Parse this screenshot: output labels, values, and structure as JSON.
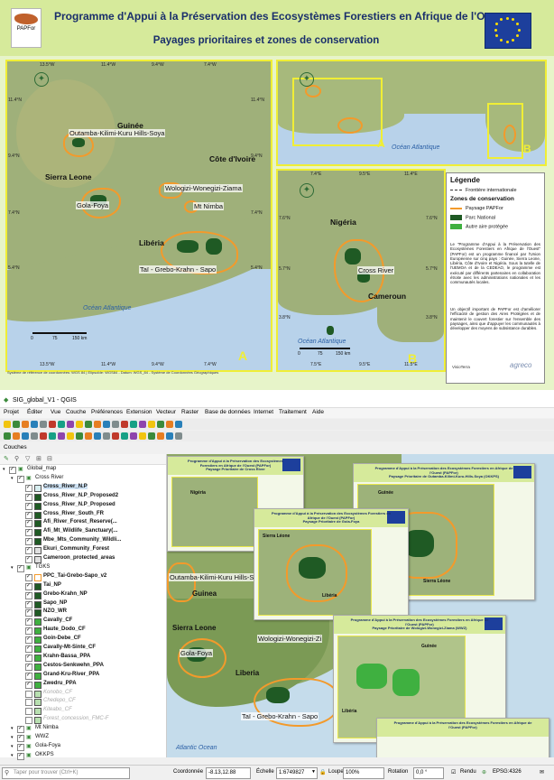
{
  "poster": {
    "title": "Programme d'Appui à la Préservation des Ecosystèmes Forestiers en Afrique de l'Ouest",
    "subtitle": "Payages prioritaires et zones de conservation",
    "logo_text": "PAPFor",
    "map_a": {
      "letter": "A",
      "countries": [
        "Guinée",
        "Côte d'Ivoire",
        "Sierra Leone",
        "Libéria"
      ],
      "landscapes": [
        "Outamba-Kilimi-Kuru Hills-Soya",
        "Gola-Foya",
        "Wologizi-Wonegizi-Ziama",
        "Mt Nimba",
        "Taï - Grebo-Krahn - Sapo"
      ],
      "ocean": "Océan Atlantique",
      "scale": [
        "0",
        "75",
        "150 km"
      ],
      "top_ticks": [
        "13.5°W",
        "11.4°W",
        "9.4°W",
        "7.4°W"
      ],
      "bottom_ticks": [
        "13.5°W",
        "11.4°W",
        "9.4°W",
        "7.4°W"
      ],
      "left_ticks": [
        "11.4°N",
        "9.4°N",
        "7.4°N",
        "5.4°N"
      ],
      "right_ticks": [
        "11.4°N",
        "9.4°N",
        "7.4°N",
        "5.4°N"
      ],
      "footnote": "Système de référence de coordonnées: WGS 84 | Elipsoïde: WGS84 - Datum: WGS_84 - Système de Coordonnées Géographiques"
    },
    "map_overview": {
      "ocean": "Océan Atlantique",
      "letter_a": "A",
      "letter_b": "B"
    },
    "map_b": {
      "letter": "B",
      "countries": [
        "Nigéria",
        "Cameroun"
      ],
      "landscapes": [
        "Cross River"
      ],
      "ocean": "Océan Atlantique",
      "scale": [
        "0",
        "75",
        "150 km"
      ],
      "top_ticks": [
        "7.4°E",
        "9.5°E",
        "11.4°E"
      ],
      "bottom_ticks": [
        "7.5°E",
        "9.5°E",
        "11.5°E"
      ],
      "left_ticks": [
        "7.6°N",
        "5.7°N",
        "3.8°N"
      ],
      "right_ticks": [
        "7.6°N",
        "5.7°N",
        "3.8°N"
      ]
    },
    "legend": {
      "title": "Légende",
      "items": [
        "Frontière internationale"
      ],
      "section": "Zones de conservation",
      "zones": [
        {
          "label": "Paysage PAPFor",
          "color": "#f39a2b"
        },
        {
          "label": "Parc National",
          "color": "#1f5a24"
        },
        {
          "label": "Autre aire protégée",
          "color": "#3fb040"
        }
      ],
      "paragraph1": "Le \"Programme d'Appui à la Préservation des Ecosystèmes Forestiers en Afrique de l'Ouest\" (PAPFor) est un programme financé par l'Union Européenne sur cinq pays : Guinée, Sierra Leone, Libéria, Côte d'Ivoire et Nigéria. Sous la tutelle de l'UEMOA et de la CEDEAO, le programme est exécuté par différents partenaires en collaboration étroite avec les administrations nationales et les communautés locales.",
      "paragraph2": "Un objectif important de PAPFor est d'améliorer l'efficacité de gestion des Aires Protégées et de maintenir le couvert forestier sur l'ensemble des paysages, ainsi que d'appuyer les communautés à développer des moyens de subsistance durables.",
      "footer_logos": [
        "VisioTerra",
        "agreco"
      ]
    }
  },
  "qgis": {
    "window_title": "SIG_global_V1 - QGIS",
    "menus": [
      "Projet",
      "Éditer",
      "Vue",
      "Couche",
      "Préférences",
      "Extension",
      "Vecteur",
      "Raster",
      "Base de données",
      "Internet",
      "Traitement",
      "Aide"
    ],
    "panel_title": "Couches",
    "layers": [
      {
        "name": "Global_map",
        "level": 0,
        "checked": true,
        "color": "",
        "style": "group"
      },
      {
        "name": "Cross River",
        "level": 1,
        "checked": true,
        "color": "",
        "style": "group"
      },
      {
        "name": "Cross_River_N.P",
        "level": 2,
        "checked": true,
        "color": "#d7eef0",
        "style": "selected"
      },
      {
        "name": "Cross_River_N.P_Proposed2",
        "level": 2,
        "checked": true,
        "color": "#1f5a24",
        "style": ""
      },
      {
        "name": "Cross_River_N.P_Proposed",
        "level": 2,
        "checked": true,
        "color": "#1f5a24",
        "style": ""
      },
      {
        "name": "Cross_River_South_FR",
        "level": 2,
        "checked": true,
        "color": "#1f5a24",
        "style": ""
      },
      {
        "name": "Afi_River_Forest_Reserve(...",
        "level": 2,
        "checked": true,
        "color": "#1f5a24",
        "style": ""
      },
      {
        "name": "Afi_Mt_Wildlife_Sanctuary(...",
        "level": 2,
        "checked": true,
        "color": "#1f5a24",
        "style": ""
      },
      {
        "name": "Mbe_Mts_Community_Wildli...",
        "level": 2,
        "checked": true,
        "color": "#1f5a24",
        "style": ""
      },
      {
        "name": "Ekuri_Community_Forest",
        "level": 2,
        "checked": true,
        "color": "#e0e0e0",
        "style": ""
      },
      {
        "name": "Cameroon_protected_areas",
        "level": 2,
        "checked": true,
        "color": "#e0e0e0",
        "style": ""
      },
      {
        "name": "TGKS",
        "level": 1,
        "checked": true,
        "color": "",
        "style": "group"
      },
      {
        "name": "PPC_Tai-Grebo-Sapo_v2",
        "level": 2,
        "checked": true,
        "color": "#ffffff",
        "style": "outline"
      },
      {
        "name": "Tai_NP",
        "level": 2,
        "checked": true,
        "color": "#1f5a24",
        "style": ""
      },
      {
        "name": "Grebo-Krahn_NP",
        "level": 2,
        "checked": true,
        "color": "#1f5a24",
        "style": ""
      },
      {
        "name": "Sapo_NP",
        "level": 2,
        "checked": true,
        "color": "#1f5a24",
        "style": ""
      },
      {
        "name": "NZO_WR",
        "level": 2,
        "checked": true,
        "color": "#1f5a24",
        "style": ""
      },
      {
        "name": "Cavally_CF",
        "level": 2,
        "checked": true,
        "color": "#3fb040",
        "style": ""
      },
      {
        "name": "Haute_Dodo_CF",
        "level": 2,
        "checked": true,
        "color": "#3fb040",
        "style": ""
      },
      {
        "name": "Goin-Debe_CF",
        "level": 2,
        "checked": true,
        "color": "#3fb040",
        "style": ""
      },
      {
        "name": "Cavally-Mt-Sinte_CF",
        "level": 2,
        "checked": true,
        "color": "#3fb040",
        "style": ""
      },
      {
        "name": "Krahn-Bassa_PPA",
        "level": 2,
        "checked": true,
        "color": "#3fb040",
        "style": ""
      },
      {
        "name": "Cestos-Senkwehn_PPA",
        "level": 2,
        "checked": true,
        "color": "#3fb040",
        "style": ""
      },
      {
        "name": "Grand-Kru-River_PPA",
        "level": 2,
        "checked": true,
        "color": "#3fb040",
        "style": ""
      },
      {
        "name": "Zwedru_PPA",
        "level": 2,
        "checked": true,
        "color": "#3fb040",
        "style": ""
      },
      {
        "name": "Konobo_CF",
        "level": 2,
        "checked": false,
        "color": "#b8e0b0",
        "style": "disabled"
      },
      {
        "name": "Chedepo_CF",
        "level": 2,
        "checked": false,
        "color": "#b8e0b0",
        "style": "disabled"
      },
      {
        "name": "Kiteabo_CF",
        "level": 2,
        "checked": false,
        "color": "#b8e0b0",
        "style": "disabled"
      },
      {
        "name": "Forest_concession_FMC-F",
        "level": 2,
        "checked": false,
        "color": "#b8e0b0",
        "style": "disabled"
      },
      {
        "name": "Mt Nimba",
        "level": 1,
        "checked": true,
        "color": "",
        "style": "group"
      },
      {
        "name": "WWZ",
        "level": 1,
        "checked": true,
        "color": "",
        "style": "group"
      },
      {
        "name": "Gola-Foya",
        "level": 1,
        "checked": true,
        "color": "",
        "style": "group"
      },
      {
        "name": "OKKPS",
        "level": 1,
        "checked": true,
        "color": "",
        "style": "group"
      }
    ],
    "canvas_labels": {
      "countries": [
        "Guinea",
        "Sierra Leone",
        "Liberia"
      ],
      "landscapes": [
        "Outamba-Kilimi-Kuru Hills-Soya",
        "Gola-Foya",
        "Wologizi-Wonegizi-Zi",
        "Taï - Grebo-Krahn - Sapo"
      ],
      "ocean": "Atlantic Ocean"
    },
    "layouts": [
      {
        "title": "Programme d'Appui à la Préservation des Ecosystèmes Forestiers en Afrique de l'Ouest (PAPFor)",
        "subtitle": "Paysage Prioritaire de Cross River"
      },
      {
        "title": "Programme d'Appui à la Préservation des Ecosystèmes Forestiers en Afrique de l'Ouest (PAPFor)",
        "subtitle": "Paysage Prioritaire de Outamba-Kilimi-Kuru-Hills-Soya (OKKPS)"
      },
      {
        "title": "Programme d'Appui à la Préservation des Ecosystèmes Forestiers en Afrique de l'Ouest (PAPFor)",
        "subtitle": "Paysage Prioritaire de Gola-Foya"
      },
      {
        "title": "Programme d'Appui à la Préservation des Ecosystèmes Forestiers en Afrique de l'Ouest (PAPFor)",
        "subtitle": "Paysage Prioritaire de Wologizi-Wonegizi-Ziama (WWZ)"
      },
      {
        "title": "Programme d'Appui à la Préservation des Ecosystèmes Forestiers en Afrique de l'Ouest (PAPFor)",
        "subtitle": ""
      }
    ],
    "layout_labels": [
      "Nigéria",
      "Guinée",
      "Sierra Léone",
      "Libéria",
      "Guinée"
    ],
    "status": {
      "search_placeholder": "Taper pour trouver (Ctrl+K)",
      "coord_label": "Coordonnée",
      "coord_value": "-8.13,12.88",
      "scale_label": "Échelle",
      "scale_value": "1:6749827",
      "magnifier_label": "Loupe",
      "magnifier_value": "100%",
      "rotation_label": "Rotation",
      "rotation_value": "0,0 °",
      "render_label": "Rendu",
      "crs": "EPSG:4326"
    }
  }
}
